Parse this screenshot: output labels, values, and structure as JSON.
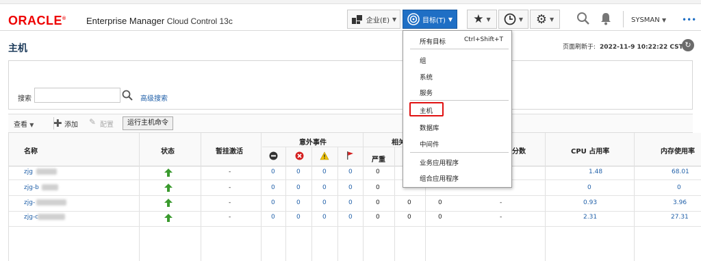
{
  "header": {
    "logo": "ORACLE",
    "product": "Enterprise Manager",
    "edition": "Cloud Control 13c",
    "enterprise_label": "企业(E)",
    "targets_label": "目标(T)",
    "username": "SYSMAN",
    "colors": {
      "brand": "#e00000",
      "active_button": "#1f6fc5"
    }
  },
  "page": {
    "title": "主机",
    "refresh_label": "页面刷新于:",
    "refresh_time": "2022-11-9 10:22:22 CST"
  },
  "search": {
    "label": "搜索",
    "value": "",
    "advanced_link": "高级搜索"
  },
  "toolbar": {
    "view_label": "查看",
    "add_label": "添加",
    "configure_label": "配置",
    "run_command_label": "运行主机命令"
  },
  "table": {
    "col_name": "名称",
    "col_status": "状态",
    "col_blackout": "暂挂激活",
    "col_incidents": "意外事件",
    "col_related": "相关",
    "col_critical": "严重",
    "col_score": "分数",
    "col_cpu": "CPU 占用率",
    "col_mem": "内存使用率",
    "rows": [
      {
        "name": "zjg",
        "blackout": "-",
        "i1": "0",
        "i2": "0",
        "i3": "0",
        "i4": "0",
        "r1": "0",
        "score": "",
        "cpu": "1.48",
        "mem": "68.01"
      },
      {
        "name": "zjg-b",
        "blackout": "-",
        "i1": "0",
        "i2": "0",
        "i3": "0",
        "i4": "0",
        "r1": "0",
        "score": "",
        "cpu": "0",
        "mem": "0"
      },
      {
        "name": "zjg-",
        "blackout": "-",
        "i1": "0",
        "i2": "0",
        "i3": "0",
        "i4": "0",
        "r1": "0",
        "r2": "0",
        "r3": "0",
        "score": "-",
        "cpu": "0.93",
        "mem": "3.96"
      },
      {
        "name": "zjg-c",
        "blackout": "-",
        "i1": "0",
        "i2": "0",
        "i3": "0",
        "i4": "0",
        "r1": "0",
        "r2": "0",
        "r3": "0",
        "score": "-",
        "cpu": "2.31",
        "mem": "27.31"
      }
    ]
  },
  "menu": {
    "all_targets": "所有目标",
    "all_targets_shortcut": "Ctrl+Shift+T",
    "groups": "组",
    "systems": "系统",
    "services": "服务",
    "hosts": "主机",
    "databases": "数据库",
    "middleware": "中间件",
    "business_apps": "业务应用程序",
    "composite_apps": "组合应用程序"
  }
}
